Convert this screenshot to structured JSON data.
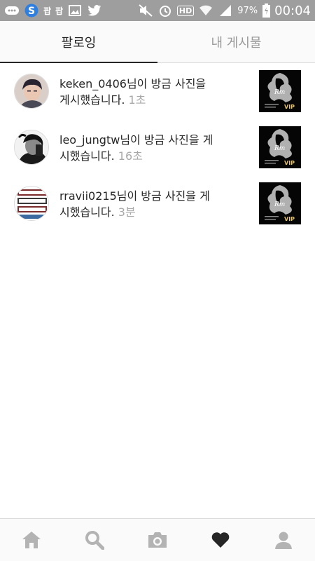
{
  "status_bar": {
    "carrier_icon_1": "팝",
    "carrier_icon_2": "팝",
    "hd_label": "HD",
    "battery": "97%",
    "time": "00:04"
  },
  "tabs": [
    {
      "label": "팔로잉",
      "active": true
    },
    {
      "label": "내 게시물",
      "active": false
    }
  ],
  "activities": [
    {
      "username": "keken_0406",
      "message": "님이 방금 사진을 게시했습니다.",
      "time": "1초"
    },
    {
      "username": "leo_jungtw",
      "message": "님이 방금 사진을 게시했습니다.",
      "time": "16초"
    },
    {
      "username": "rravii0215",
      "message": "님이 방금 사진을 게시했습니다.",
      "time": "3분"
    }
  ],
  "bottom_nav": [
    "home-icon",
    "search-icon",
    "camera-icon",
    "heart-icon",
    "profile-icon"
  ],
  "colors": {
    "text": "#262626",
    "muted": "#a8a8a8",
    "statusbar": "#9e9e9e",
    "icon_inactive": "#b3b3b3",
    "icon_active": "#262626"
  }
}
